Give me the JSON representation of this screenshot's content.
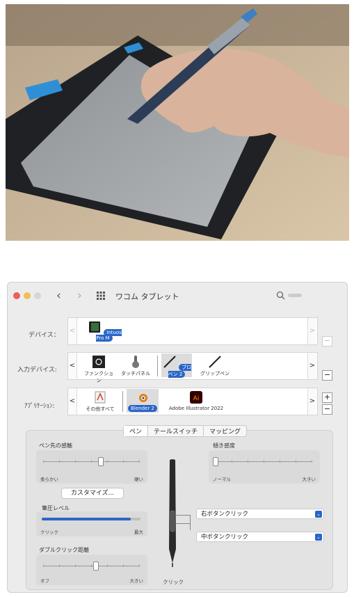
{
  "window": {
    "title": "ワコム タブレット"
  },
  "rows": {
    "device": {
      "label": "デバイス：",
      "items": [
        {
          "label": "Intuos Pro M",
          "selected": true,
          "icon": "tablet-icon"
        }
      ]
    },
    "input": {
      "label": "入力デバイス:",
      "items": [
        {
          "label": "ファンクション",
          "icon": "function-keys-icon",
          "selected": false
        },
        {
          "label": "タッチパネル",
          "icon": "touch-hand-icon",
          "selected": false
        },
        {
          "label": "プロペン 2",
          "icon": "pro-pen-icon",
          "selected": true
        },
        {
          "label": "グリップペン",
          "icon": "grip-pen-icon",
          "selected": false
        }
      ]
    },
    "app": {
      "label": "ｱﾌﾟﾘｹｰｼｮﾝ:",
      "items": [
        {
          "label": "その他すべて",
          "icon": "all-apps-icon",
          "selected": false
        },
        {
          "label": "Blender 2",
          "icon": "blender-icon",
          "selected": true
        },
        {
          "label": "Adobe Illustrator 2022",
          "icon": "illustrator-icon",
          "selected": false
        }
      ]
    }
  },
  "tabs": [
    "ペン",
    "テールスイッチ",
    "マッピング"
  ],
  "pen_tab": {
    "tip_feel": {
      "label": "ペン先の感触",
      "min": "柔らかい",
      "max": "硬い",
      "level": 0.6
    },
    "customize_button": "カスタマイズ...",
    "pressure": {
      "label": "筆圧レベル",
      "min": "クリック",
      "max": "最大",
      "level": 0.9
    },
    "double_click": {
      "label": "ダブルクリック距離",
      "min": "オフ",
      "max": "大きい",
      "level": 0.55
    },
    "tilt": {
      "label": "傾き感度",
      "min": "ノーマル",
      "max": "大きい",
      "level": 0.0
    },
    "upper_button": "右ボタンクリック",
    "lower_button": "中ボタンクリック",
    "tip_action": "クリック"
  },
  "colors": {
    "accent": "#2a66c8",
    "close": "#ec5f56",
    "minimize": "#f4bd4f",
    "zoom": "#d6d6d6"
  }
}
